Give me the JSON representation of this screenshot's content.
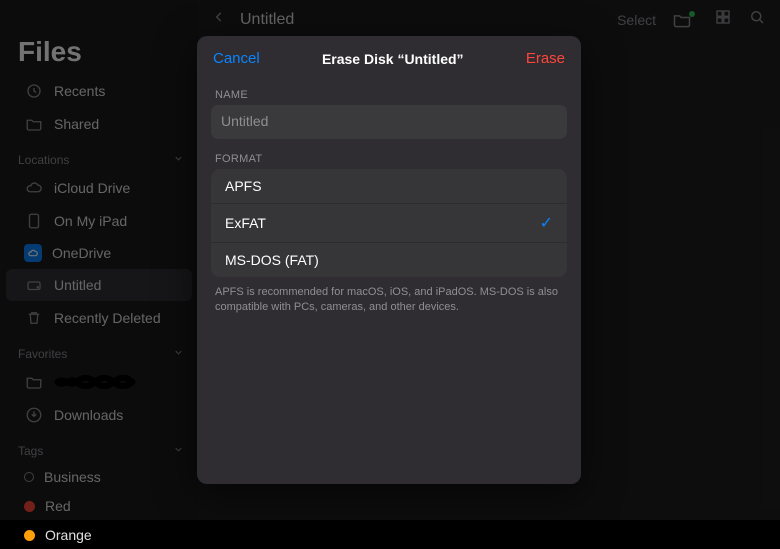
{
  "colors": {
    "accent": "#0a84ff",
    "destructive": "#ff453a",
    "bgModal": "#2f2d31"
  },
  "ellipsis": "•••",
  "sidebar": {
    "title": "Files",
    "quick": [
      {
        "label": "Recents",
        "icon": "clock-icon"
      },
      {
        "label": "Shared",
        "icon": "folder-person-icon"
      }
    ],
    "locations_label": "Locations",
    "locations": [
      {
        "label": "iCloud Drive",
        "icon": "cloud-icon"
      },
      {
        "label": "On My iPad",
        "icon": "ipad-icon"
      },
      {
        "label": "OneDrive",
        "icon": "onedrive-icon"
      },
      {
        "label": "Untitled",
        "icon": "drive-icon",
        "active": true
      },
      {
        "label": "Recently Deleted",
        "icon": "trash-icon"
      }
    ],
    "favorites_label": "Favorites",
    "favorites": [
      {
        "label": "",
        "icon": "folder-icon",
        "redacted": true
      },
      {
        "label": "Downloads",
        "icon": "download-icon"
      }
    ],
    "tags_label": "Tags",
    "tags": [
      {
        "label": "Business",
        "color": "hollow"
      },
      {
        "label": "Red",
        "color": "#ff453a"
      },
      {
        "label": "Orange",
        "color": "#ff9f0a"
      }
    ]
  },
  "main": {
    "title": "Untitled",
    "select_label": "Select"
  },
  "modal": {
    "cancel": "Cancel",
    "erase": "Erase",
    "title": "Erase Disk “Untitled”",
    "name_label": "NAME",
    "name_placeholder": "Untitled",
    "name_value": "",
    "format_label": "FORMAT",
    "formats": [
      {
        "label": "APFS",
        "selected": false
      },
      {
        "label": "ExFAT",
        "selected": true
      },
      {
        "label": "MS-DOS (FAT)",
        "selected": false
      }
    ],
    "help": "APFS is recommended for macOS, iOS, and iPadOS. MS-DOS is also compatible with PCs, cameras, and other devices."
  }
}
